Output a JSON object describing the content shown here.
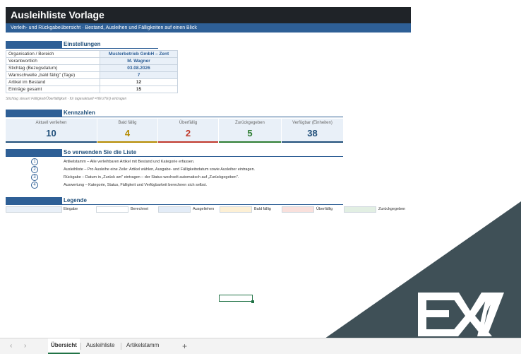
{
  "header": {
    "title": "Ausleihliste Vorlage",
    "subtitle": "Verleih- und Rückgabeübersicht · Bestand, Ausleihen und Fälligkeiten auf einen Blick"
  },
  "settings": {
    "heading": "Einstellungen",
    "rows": [
      {
        "label": "Organisation / Bereich",
        "value": "Musterbetrieb GmbH – Zent"
      },
      {
        "label": "Verantwortlich",
        "value": "M. Wagner"
      },
      {
        "label": "Stichtag (Bezugsdatum)",
        "value": "03.08.2026"
      },
      {
        "label": "Warnschwelle „bald fällig\" (Tage)",
        "value": "7"
      },
      {
        "label": "Artikel im Bestand",
        "value": "12"
      },
      {
        "label": "Einträge gesamt",
        "value": "15"
      }
    ],
    "note": "Stichtag steuert Fälligkeit/Überfälligkeit · für tagesaktuell =HEUTE() eintragen"
  },
  "kpis": {
    "heading": "Kennzahlen",
    "items": [
      {
        "label": "Aktuell verliehen",
        "value": "10",
        "color": "#1f4e79"
      },
      {
        "label": "Bald fällig",
        "value": "4",
        "color": "#b58b00"
      },
      {
        "label": "Überfällig",
        "value": "2",
        "color": "#c0392b"
      },
      {
        "label": "Zurückgegeben",
        "value": "5",
        "color": "#2e7d32"
      },
      {
        "label": "Verfügbar (Einheiten)",
        "value": "38",
        "color": "#1f4e79"
      }
    ]
  },
  "howto": {
    "heading": "So verwenden Sie die Liste",
    "steps": [
      {
        "num": "1",
        "text": "Artikelstamm – Alle verleihbaren Artikel mit Bestand und Kategorie erfassen."
      },
      {
        "num": "2",
        "text": "Ausleihliste – Pro Ausleihe eine Zeile: Artikel wählen, Ausgabe- und Fälligkeitsdatum sowie Ausleiher eintragen."
      },
      {
        "num": "3",
        "text": "Rückgabe – Datum in „Zurück am\" eintragen – der Status wechselt automatisch auf „Zurückgegeben\"."
      },
      {
        "num": "4",
        "text": "Auswertung – Kategorie, Status, Fälligkeit und Verfügbarkeit berechnen sich selbst."
      }
    ]
  },
  "legend": {
    "heading": "Legende",
    "items": [
      {
        "label": "Eingabe",
        "color": "#e9f0f8"
      },
      {
        "label": "Berechnet",
        "color": "#ffffff"
      },
      {
        "label": "Ausgeliehen",
        "color": "#e3ecf7"
      },
      {
        "label": "Bald fällig",
        "color": "#fdf0d5"
      },
      {
        "label": "Überfällig",
        "color": "#f9e0dc"
      },
      {
        "label": "Zurückgegeben",
        "color": "#e2efe3"
      }
    ]
  },
  "tabs": {
    "prev": "‹",
    "next": "›",
    "items": [
      "Übersicht",
      "Ausleihliste",
      "Artikelstamm"
    ],
    "add": "+"
  },
  "brand": {
    "logo_text": "EXV",
    "overlay_color": "#3f5057"
  }
}
